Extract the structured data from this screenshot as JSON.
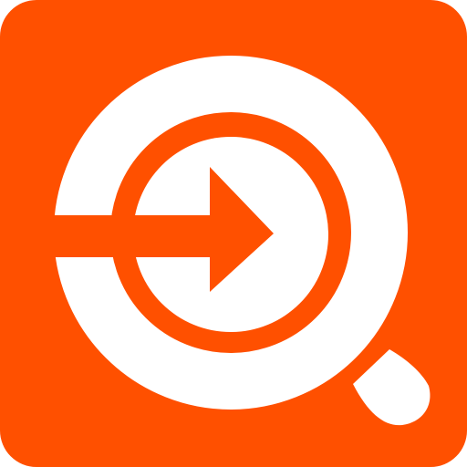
{
  "icon": {
    "name": "search-enter-icon",
    "colors": {
      "background": "#FF5000",
      "foreground": "#FFFFFF"
    }
  }
}
